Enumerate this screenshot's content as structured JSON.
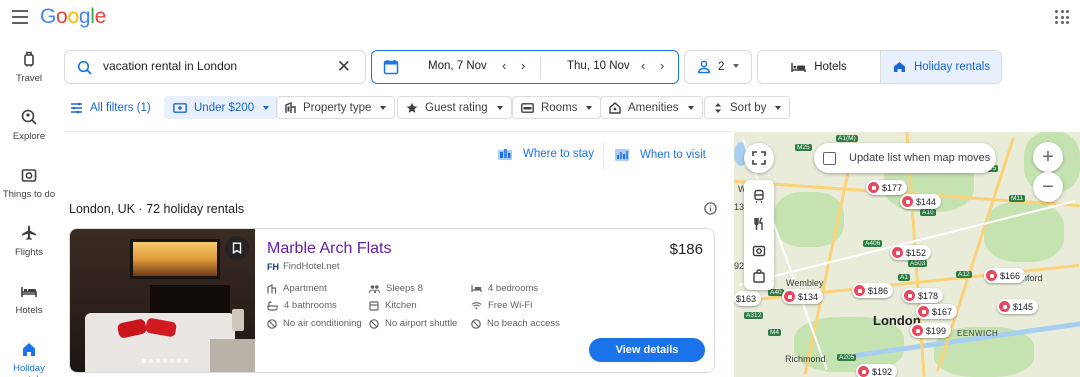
{
  "brand": {
    "letters": [
      {
        "ch": "G",
        "color": "#4285F4"
      },
      {
        "ch": "o",
        "color": "#EA4335"
      },
      {
        "ch": "o",
        "color": "#FBBC05"
      },
      {
        "ch": "g",
        "color": "#4285F4"
      },
      {
        "ch": "l",
        "color": "#34A853"
      },
      {
        "ch": "e",
        "color": "#EA4335"
      }
    ]
  },
  "nav": {
    "travel": "Travel",
    "explore": "Explore",
    "things": "Things to do",
    "flights": "Flights",
    "hotels": "Hotels",
    "rentals": "Holiday rentals"
  },
  "search": {
    "query": "vacation rental in London",
    "check_in": "Mon, 7 Nov",
    "check_out": "Thu, 10 Nov",
    "guests": "2",
    "tab_hotels": "Hotels",
    "tab_rentals": "Holiday rentals",
    "active_tab": "Holiday rentals"
  },
  "filters": {
    "all": "All filters (1)",
    "price": "Under $200",
    "property": "Property type",
    "rating": "Guest rating",
    "rooms": "Rooms",
    "amenities": "Amenities",
    "sort": "Sort by"
  },
  "shortcuts": {
    "where": "Where to stay",
    "when": "When to visit"
  },
  "results": {
    "title": "London, UK · 72 holiday rentals"
  },
  "listing": {
    "name": "Marble Arch Flats",
    "provider": "FindHotel.net",
    "provider_mark": "FH",
    "price": "$186",
    "amenities": [
      "Apartment",
      "Sleeps 8",
      "4 bedrooms",
      "4 bathrooms",
      "Kitchen",
      "Free Wi-Fi",
      "No air conditioning",
      "No airport shuttle",
      "No beach access"
    ],
    "button": "View details",
    "photo_count": 7,
    "photo_index": 1
  },
  "map": {
    "update_label": "Update list when map moves",
    "zoom_in": "+",
    "zoom_out": "−",
    "city": "London",
    "places": {
      "wembley": "Wembley",
      "romford": "Romford",
      "richmond": "Richmond",
      "greenwich": "EENWICH",
      "w": "W",
      "n13": "13",
      "n92": "92"
    },
    "roads": {
      "a1m": "A1(M)",
      "m25": "M25",
      "a10": "A10",
      "m11": "M11",
      "a406": "A406",
      "a12": "A12",
      "a40": "A40",
      "m4": "M4",
      "a312": "A312",
      "a205": "A205",
      "a1": "A1",
      "a503": "A503",
      "n25": "25"
    },
    "prices": {
      "p177": "$177",
      "p144": "$144",
      "p152": "$152",
      "p166": "$166",
      "p145": "$145",
      "p186": "$186",
      "p178": "$178",
      "p134": "$134",
      "p163": "$163",
      "p167": "$167",
      "p199": "$199",
      "p192": "$192"
    }
  },
  "colors": {
    "accent": "#1a73e8",
    "visited_link": "#681da8",
    "pin": "#e8475f"
  }
}
